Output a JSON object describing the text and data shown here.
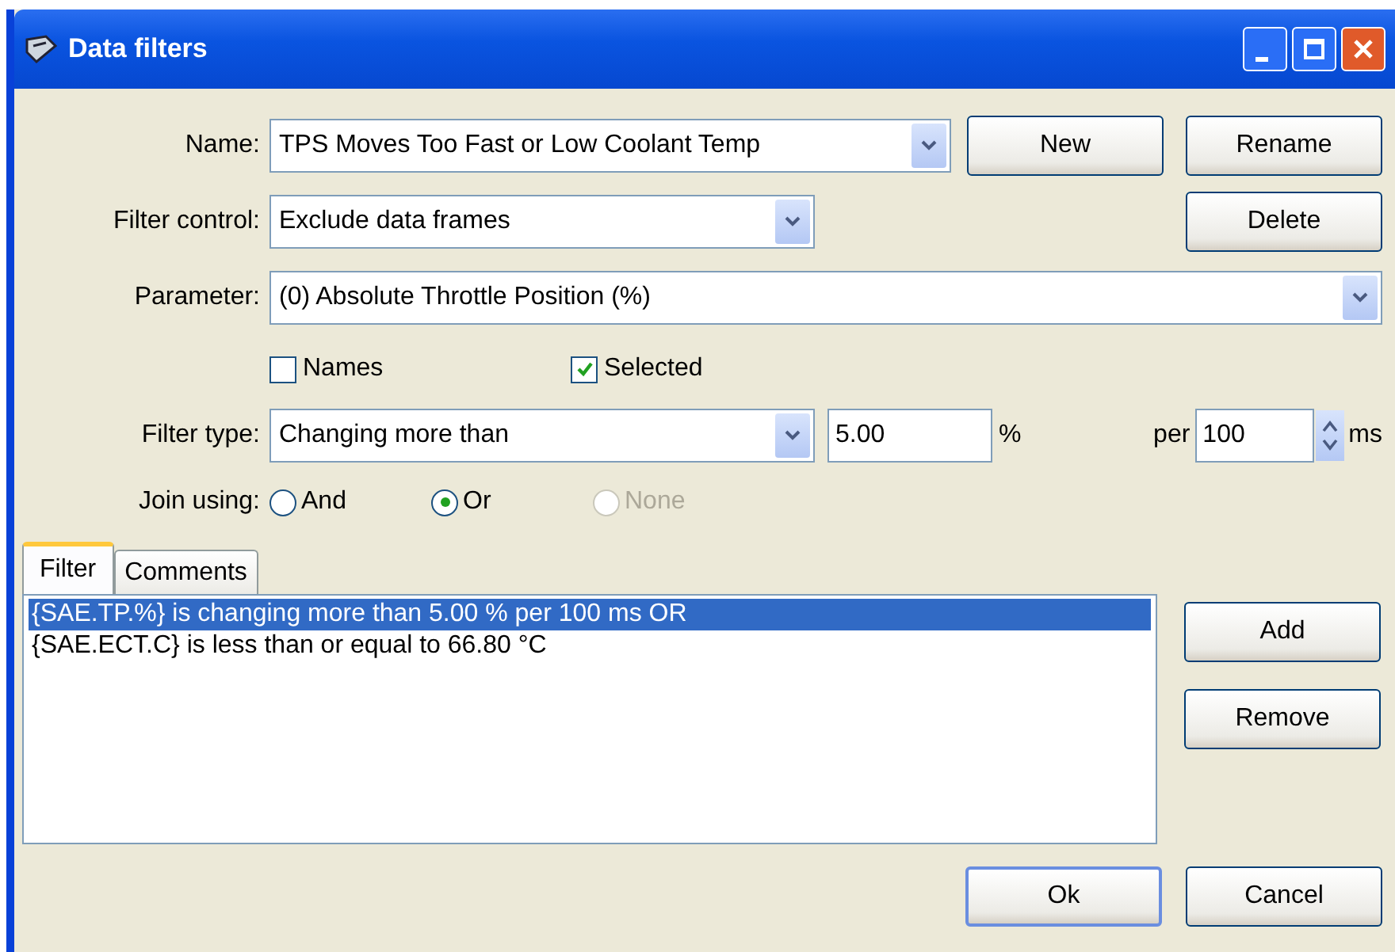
{
  "window": {
    "title": "Data filters"
  },
  "name": {
    "label": "Name:",
    "value": "TPS Moves Too Fast or Low Coolant Temp"
  },
  "top_buttons": [
    "New",
    "Rename"
  ],
  "filter_control": {
    "label": "Filter control:",
    "value": "Exclude data frames"
  },
  "delete_button": "Delete",
  "parameter": {
    "label": "Parameter:",
    "value": "(0) Absolute Throttle Position (%)"
  },
  "options": [
    {
      "label": "Names",
      "checked": false
    },
    {
      "label": "Selected",
      "checked": true
    }
  ],
  "filter_type": {
    "label": "Filter type:",
    "value": "Changing more than",
    "amount": "5.00",
    "unit": "%",
    "per_label": "per",
    "period": "100",
    "period_unit": "ms"
  },
  "join": {
    "label": "Join using:",
    "choices": [
      {
        "label": "And",
        "selected": false,
        "disabled": false
      },
      {
        "label": "Or",
        "selected": true,
        "disabled": false
      },
      {
        "label": "None",
        "selected": false,
        "disabled": true
      }
    ]
  },
  "tabs": [
    {
      "label": "Filter",
      "selected": true
    },
    {
      "label": "Comments",
      "selected": false
    }
  ],
  "filter_list": [
    {
      "text": "{SAE.TP.%} is changing more than 5.00 % per 100 ms OR",
      "selected": true
    },
    {
      "text": "{SAE.ECT.C} is less than or equal to 66.80 °C",
      "selected": false
    }
  ],
  "list_buttons": [
    "Add",
    "Remove"
  ],
  "dialog_buttons": [
    "Ok",
    "Cancel"
  ]
}
